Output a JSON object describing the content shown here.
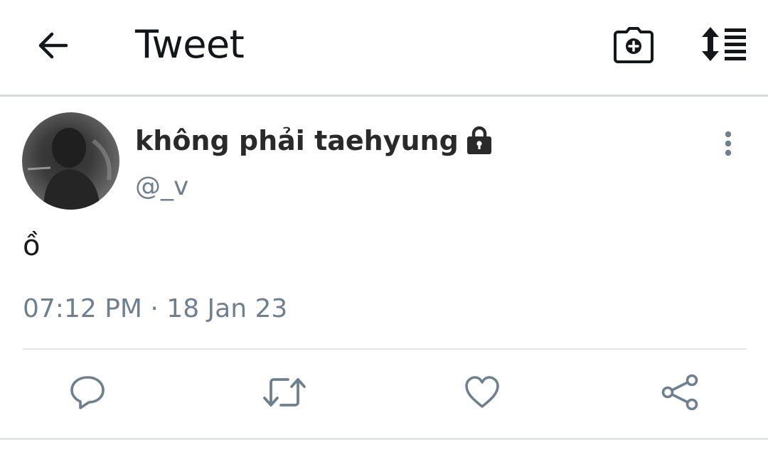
{
  "header": {
    "title": "Tweet",
    "back_icon": "arrow-left-icon",
    "camera_icon": "camera-add-icon",
    "sort_icon": "sort-list-icon"
  },
  "tweet": {
    "author_name": "không phải taehyung",
    "protected_icon": "lock-icon",
    "handle": "@_v",
    "text": "ồ",
    "timestamp": "07:12 PM · 18 Jan 23"
  },
  "actions": {
    "reply_icon": "reply-icon",
    "retweet_icon": "retweet-icon",
    "like_icon": "heart-icon",
    "share_icon": "share-icon"
  },
  "colors": {
    "text_primary": "#14171a",
    "text_secondary": "#6e7f8f",
    "icon_gray": "#6e7f8f",
    "divider": "#e3e6e8"
  }
}
